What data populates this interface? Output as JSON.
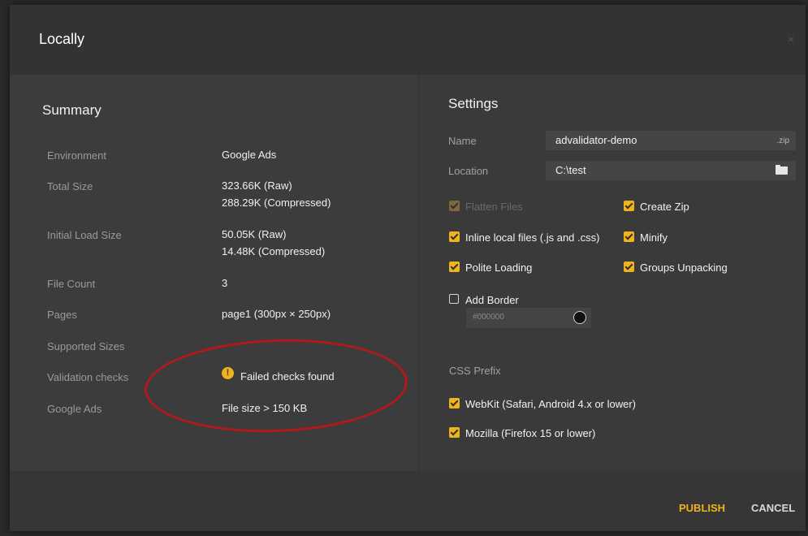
{
  "dialog": {
    "title": "Locally",
    "close_icon": "×"
  },
  "summary": {
    "title": "Summary",
    "rows": [
      {
        "label": "Environment",
        "value": "Google Ads"
      },
      {
        "label": "Total Size",
        "value": "323.66K (Raw)",
        "value2": "288.29K (Compressed)"
      },
      {
        "label": "Initial Load Size",
        "value": "50.05K (Raw)",
        "value2": "14.48K (Compressed)"
      },
      {
        "label": "File Count",
        "value": "3"
      },
      {
        "label": "Pages",
        "value": "page1 (300px × 250px)"
      },
      {
        "label": "Supported Sizes",
        "value": ""
      },
      {
        "label": "Validation checks",
        "value": "Failed checks found",
        "icon": "warning-icon"
      },
      {
        "label": "Google Ads",
        "value": "File size > 150 KB"
      }
    ],
    "warning_glyph": "!",
    "accent_color": "#f2b21b",
    "highlight_color": "#b3181a"
  },
  "settings": {
    "title": "Settings",
    "name_label": "Name",
    "name_value": "advalidator-demo",
    "name_suffix": ".zip",
    "location_label": "Location",
    "location_value": "C:\\test",
    "options": {
      "flatten_files": {
        "label": "Flatten Files",
        "checked": true,
        "disabled": true
      },
      "create_zip": {
        "label": "Create Zip",
        "checked": true
      },
      "inline_local": {
        "label": "Inline local files (.js and .css)",
        "checked": true
      },
      "minify": {
        "label": "Minify",
        "checked": true
      },
      "polite_loading": {
        "label": "Polite Loading",
        "checked": true
      },
      "groups_unpacking": {
        "label": "Groups Unpacking",
        "checked": true
      },
      "add_border": {
        "label": "Add Border",
        "checked": false
      }
    },
    "border_color_value": "#000000",
    "css_prefix_label": "CSS Prefix",
    "webkit": {
      "label": "WebKit (Safari, Android 4.x or lower)",
      "checked": true
    },
    "mozilla": {
      "label": "Mozilla (Firefox 15 or lower)",
      "checked": true
    }
  },
  "footer": {
    "publish_label": "PUBLISH",
    "cancel_label": "CANCEL",
    "publish_color": "#f0b31c"
  }
}
